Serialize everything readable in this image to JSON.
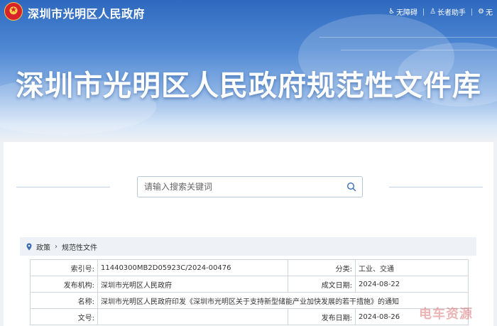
{
  "header": {
    "site_name": "深圳市光明区人民政府",
    "tools": [
      {
        "label": "无障碍",
        "icon": "accessibility-icon"
      },
      {
        "label": "长者助手",
        "icon": "elder-assist-icon"
      },
      {
        "label": "无",
        "icon": "settings-icon"
      }
    ]
  },
  "hero": {
    "title": "深圳市光明区人民政府规范性文件库"
  },
  "search": {
    "placeholder": "请输入搜索关键词",
    "icon": "search-icon"
  },
  "breadcrumb": {
    "icon": "location-pin-icon",
    "items": [
      "政策",
      "规范性文件"
    ]
  },
  "meta_table": {
    "index_label": "索引号:",
    "index_value": "11440300MB2D05923C/2024-00476",
    "category_label": "分类:",
    "category_value": "工业、交通",
    "issuer_label": "发布机构:",
    "issuer_value": "深圳市光明区人民政府",
    "written_label": "成文日期:",
    "written_value": "2024-08-22",
    "name_label": "名称:",
    "name_value": "深圳市光明区人民政府印发《深圳市光明区关于支持新型储能产业加快发展的若干措施》的通知",
    "docno_label": "文号:",
    "docno_value": "",
    "published_label": "发布日期:",
    "published_value": "2024-08-26"
  },
  "watermark": "电车资源",
  "colors": {
    "banner": "#2e69bf",
    "accent": "#1b5fb6",
    "border": "#cfd6df"
  }
}
